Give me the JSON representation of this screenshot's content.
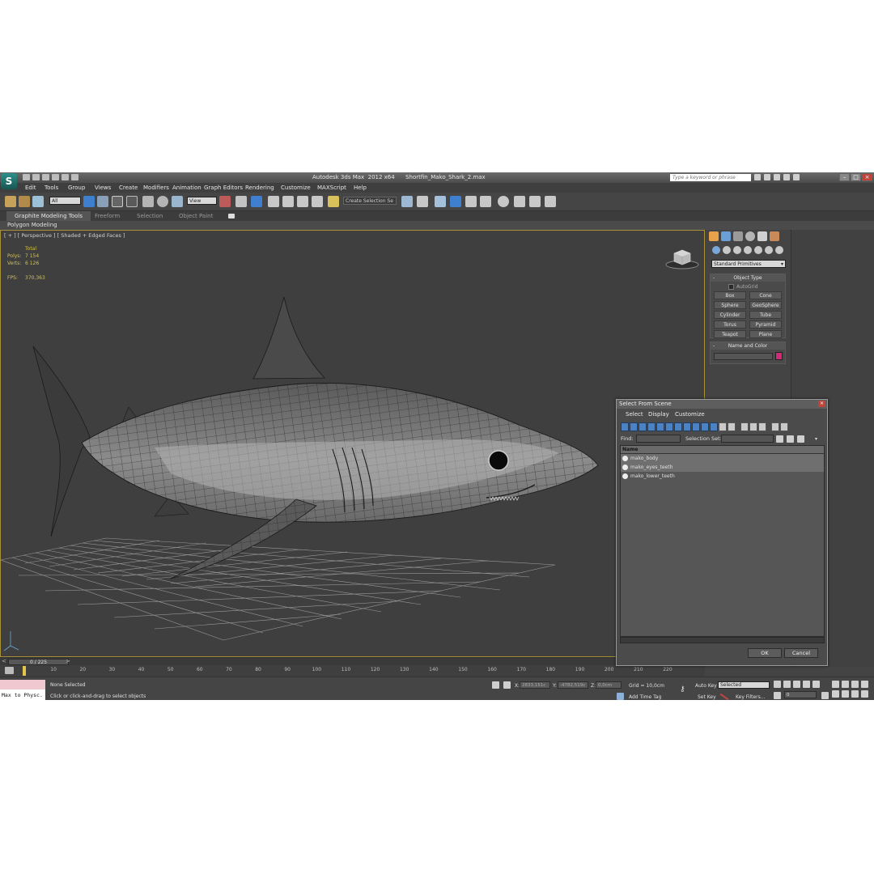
{
  "app": {
    "title": "Autodesk 3ds Max  2012 x64      Shortfin_Mako_Shark_2.max",
    "search_placeholder": "Type a keyword or phrase",
    "logo_icon": "3dsmax-logo-icon"
  },
  "menu": [
    "Edit",
    "Tools",
    "Group",
    "Views",
    "Create",
    "Modifiers",
    "Animation",
    "Graph Editors",
    "Rendering",
    "Customize",
    "MAXScript",
    "Help"
  ],
  "toolbar": {
    "filter_value": "All",
    "coord_value": "View",
    "selection_set_placeholder": "Create Selection Se"
  },
  "ribbon": {
    "tabs": [
      "Graphite Modeling Tools",
      "Freeform",
      "Selection",
      "Object Paint"
    ],
    "panel": "Polygon Modeling"
  },
  "viewport": {
    "label": "[ + ] [ Perspective ] [ Shaded + Edged Faces ]",
    "stats_header": "Total",
    "polys_label": "Polys:",
    "polys_value": "7 154",
    "verts_label": "Verts:",
    "verts_value": "6 126",
    "fps_label": "FPS:",
    "fps_value": "370,363"
  },
  "command_panel": {
    "category": "Standard Primitives",
    "object_type_title": "Object Type",
    "autogrid": "AutoGrid",
    "buttons": [
      "Box",
      "Cone",
      "Sphere",
      "GeoSphere",
      "Cylinder",
      "Tube",
      "Torus",
      "Pyramid",
      "Teapot",
      "Plane"
    ],
    "name_color_title": "Name and Color",
    "swatch_color": "#d12b78"
  },
  "dialog": {
    "title": "Select From Scene",
    "menu": [
      "Select",
      "Display",
      "Customize"
    ],
    "find_label": "Find:",
    "selection_set_label": "Selection Set:",
    "column_header": "Name",
    "items": [
      "mako_body",
      "mako_eyes_teeth",
      "mako_lower_teeth"
    ],
    "ok": "OK",
    "cancel": "Cancel"
  },
  "timeline": {
    "frame": "0 / 225",
    "ticks": [
      "10",
      "20",
      "30",
      "40",
      "50",
      "60",
      "70",
      "80",
      "90",
      "100",
      "110",
      "120",
      "130",
      "140",
      "150",
      "160",
      "170",
      "180",
      "190",
      "200",
      "210",
      "220"
    ]
  },
  "status": {
    "maxscript": "Max to Physc.",
    "selection": "None Selected",
    "prompt": "Click or click-and-drag to select objects",
    "x_label": "X:",
    "x_value": "2833,151c",
    "y_label": "Y:",
    "y_value": "-4782,519c",
    "z_label": "Z:",
    "z_value": "0,0cm",
    "grid": "Grid = 10,0cm",
    "add_time_tag": "Add Time Tag",
    "auto_key": "Auto Key",
    "key_mode": "Selected",
    "set_key": "Set Key",
    "key_filters": "Key Filters...",
    "frame_field": "0"
  }
}
